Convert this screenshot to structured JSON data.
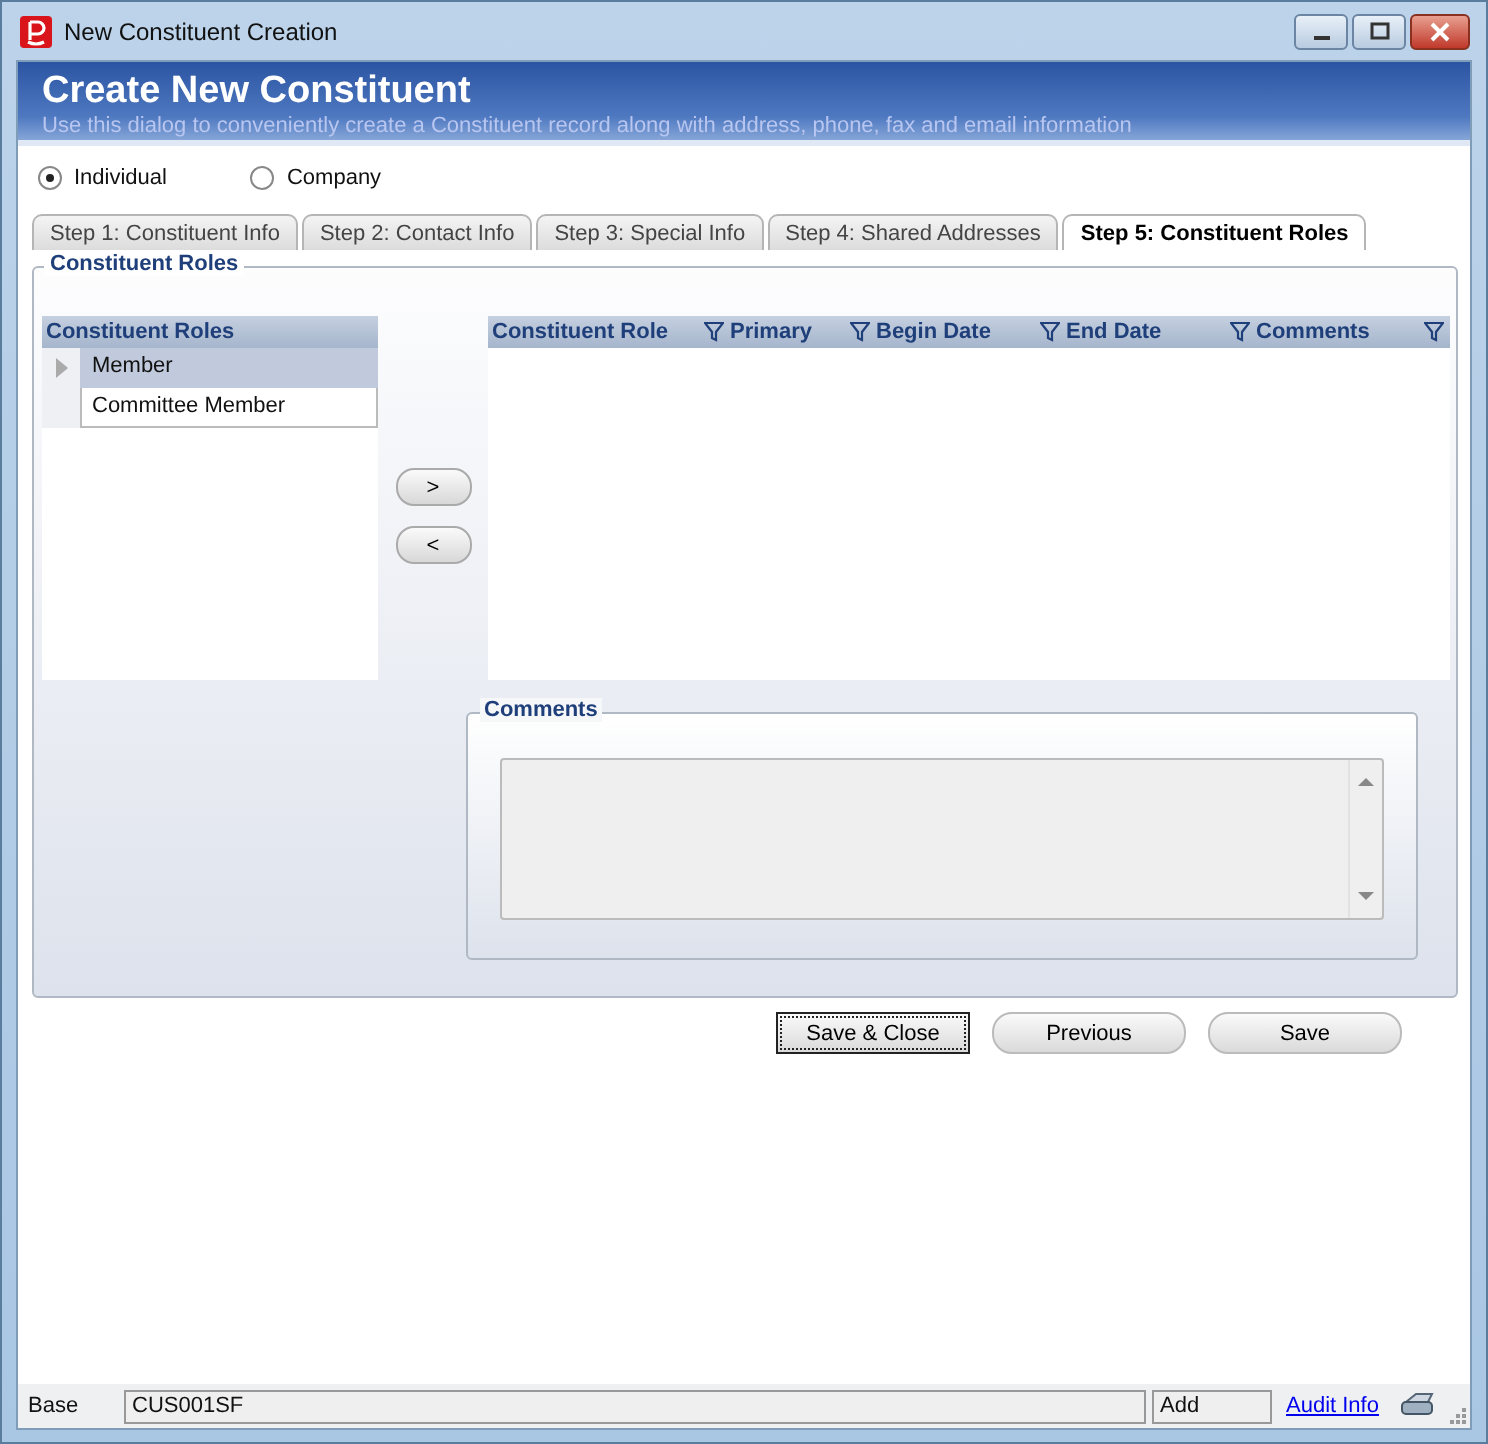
{
  "window": {
    "title": "New Constituent Creation"
  },
  "header": {
    "title": "Create New Constituent",
    "subtitle": "Use this dialog to conveniently create a Constituent record along with address, phone, fax and email information"
  },
  "constituent_type": [
    {
      "label": "Individual",
      "selected": true
    },
    {
      "label": "Company",
      "selected": false
    }
  ],
  "tabs": [
    {
      "label": "Step 1: Constituent Info",
      "selected": false
    },
    {
      "label": "Step 2: Contact Info",
      "selected": false
    },
    {
      "label": "Step 3: Special Info",
      "selected": false
    },
    {
      "label": "Step 4: Shared Addresses",
      "selected": false
    },
    {
      "label": "Step 5: Constituent Roles",
      "selected": true
    }
  ],
  "group_title": "Constituent Roles",
  "roles_list": {
    "heading": "Constituent Roles",
    "items": [
      {
        "label": "Member",
        "selected": true
      },
      {
        "label": "Committee Member",
        "selected": false
      }
    ]
  },
  "move_buttons": [
    ">",
    "<"
  ],
  "roles_grid": {
    "columns": [
      {
        "label": "Constituent Role",
        "filter": false
      },
      {
        "label": "Primary",
        "filter": true
      },
      {
        "label": "Begin Date",
        "filter": true
      },
      {
        "label": "End Date",
        "filter": true
      },
      {
        "label": "Comments",
        "filter": true
      },
      {
        "filter": true
      }
    ]
  },
  "comments": {
    "title": "Comments"
  },
  "buttons": [
    {
      "label": "Save & Close",
      "focused": true
    },
    {
      "label": "Previous",
      "focused": false
    },
    {
      "label": "Save",
      "focused": false
    }
  ],
  "status_bar": {
    "label": "Base",
    "code": "CUS001SF",
    "mode": "Add",
    "link": "Audit Info"
  }
}
